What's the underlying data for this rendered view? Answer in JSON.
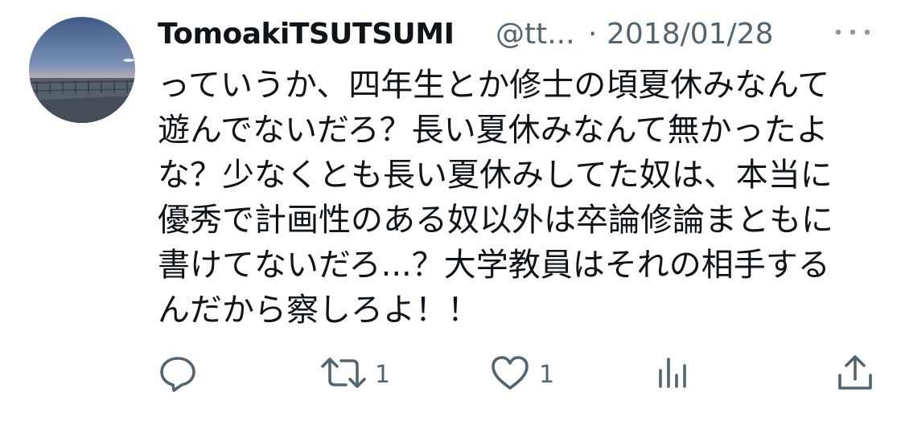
{
  "author": {
    "display_name": "TomoakiTSUTSUMI",
    "handle": "@tt...",
    "separator": "·",
    "date": "2018/01/28",
    "avatar_icon": "sunset-photo-avatar"
  },
  "tweet": {
    "lines": [
      "っていうか、四年生とか修士の頃夏休みなんて",
      "遊んでないだろ？長い夏休みなんて無かったよ",
      "な？少なくとも長い夏休みしてた奴は、本当に",
      "優秀で計画性のある奴以外は卒論修論まともに",
      "書けてないだろ...？大学教員はそれの相手する",
      "んだから察しろよ！！"
    ]
  },
  "actions": {
    "reply_icon": "reply-bubble-icon",
    "retweet_icon": "retweet-icon",
    "retweet_count": "1",
    "like_icon": "heart-icon",
    "like_count": "1",
    "views_icon": "analytics-bars-icon",
    "share_icon": "share-upload-icon"
  },
  "colors": {
    "text": "#0f1419",
    "secondary": "#536471"
  }
}
